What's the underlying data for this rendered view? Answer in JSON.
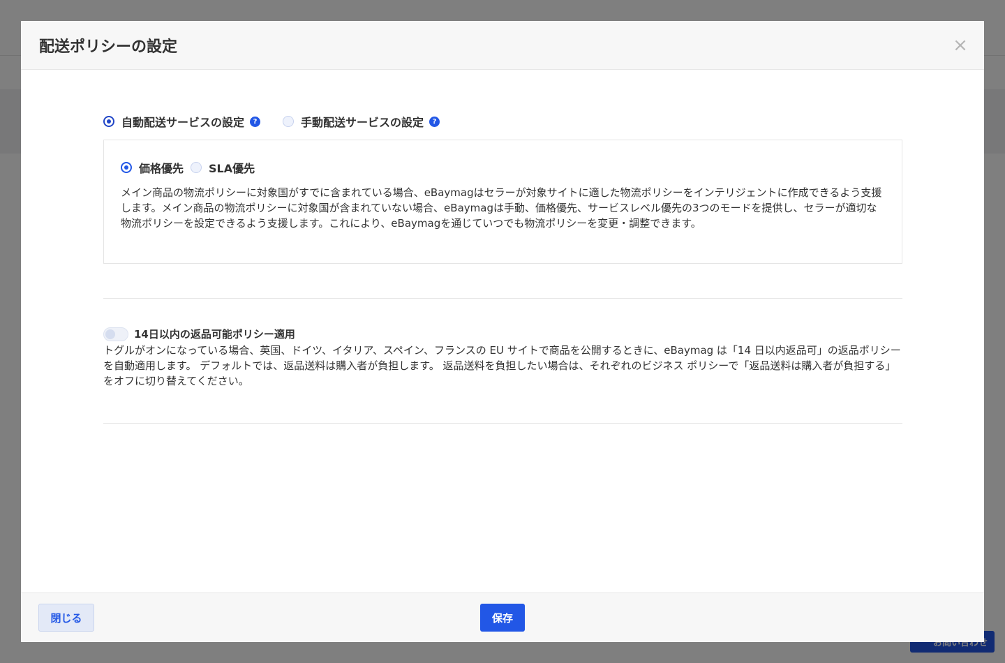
{
  "background": {
    "contact_button": "お問い合わせ"
  },
  "modal": {
    "title": "配送ポリシーの設定",
    "close_icon": "close-icon",
    "shipping_mode": {
      "options": [
        {
          "label": "自動配送サービスの設定",
          "selected": true
        },
        {
          "label": "手動配送サービスの設定",
          "selected": false
        }
      ],
      "help_glyph": "?"
    },
    "auto_settings": {
      "options": [
        {
          "label": "価格優先",
          "selected": true
        },
        {
          "label": "SLA優先",
          "selected": false
        }
      ],
      "description": "メイン商品の物流ポリシーに対象国がすでに含まれている場合、eBaymagはセラーが対象サイトに適した物流ポリシーをインテリジェントに作成できるよう支援します。メイン商品の物流ポリシーに対象国が含まれていない場合、eBaymagは手動、価格優先、サービスレベル優先の3つのモードを提供し、セラーが適切な物流ポリシーを設定できるよう支援します。これにより、eBaymagを通じていつでも物流ポリシーを変更・調整できます。"
    },
    "return_policy": {
      "label": "14日以内の返品可能ポリシー適用",
      "enabled": false,
      "description": "トグルがオンになっている場合、英国、ドイツ、イタリア、スペイン、フランスの EU サイトで商品を公開するときに、eBaymag は「14 日以内返品可」の返品ポリシーを自動適用します。 デフォルトでは、返品送料は購入者が負担します。 返品送料を負担したい場合は、それぞれのビジネス ポリシーで「返品送料は購入者が負担する」をオフに切り替えてください。"
    },
    "footer": {
      "close_label": "閉じる",
      "save_label": "保存"
    }
  },
  "colors": {
    "accent": "#2257e6",
    "radio_selected": "#2146c7",
    "overlay": "#7f7f7f"
  }
}
